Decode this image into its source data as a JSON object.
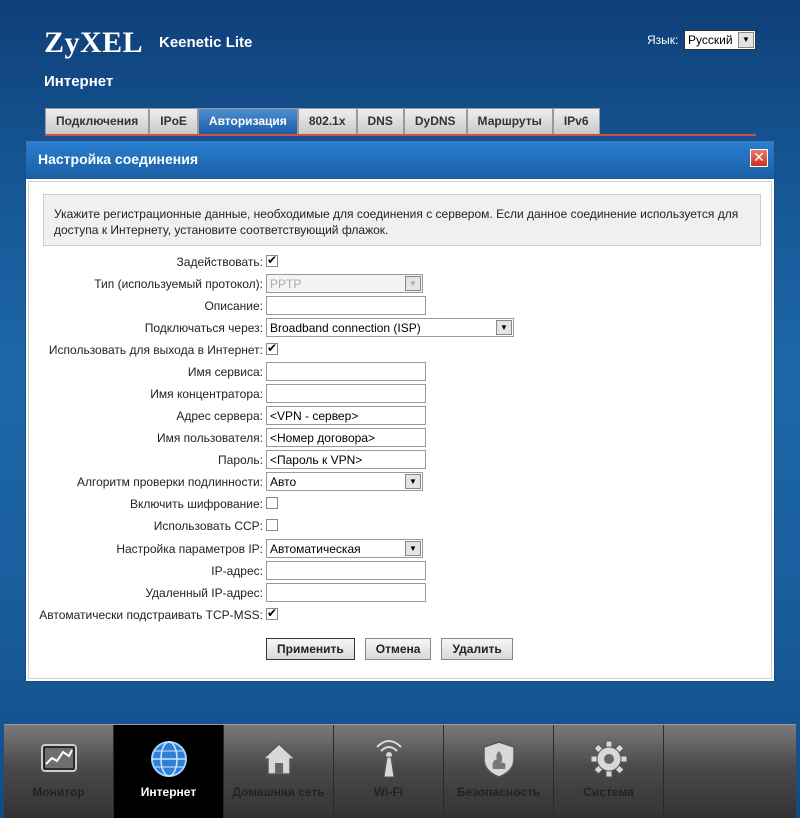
{
  "brand": {
    "logo": "ZyXEL",
    "model": "Keenetic Lite"
  },
  "language": {
    "label": "Язык:",
    "selected": "Русский"
  },
  "section_title": "Интернет",
  "tabs": [
    {
      "label": "Подключения"
    },
    {
      "label": "IPoE"
    },
    {
      "label": "Авторизация"
    },
    {
      "label": "802.1x"
    },
    {
      "label": "DNS"
    },
    {
      "label": "DyDNS"
    },
    {
      "label": "Маршруты"
    },
    {
      "label": "IPv6"
    }
  ],
  "dialog": {
    "title": "Настройка соединения",
    "close": "✕",
    "info": "Укажите регистрационные данные, необходимые для соединения с сервером. Если данное соединение используется для доступа к Интернету, установите соответствующий флажок.",
    "fields": {
      "enable": {
        "label": "Задействовать:",
        "checked": true
      },
      "type": {
        "label": "Тип (используемый протокол):",
        "value": "PPTP"
      },
      "description": {
        "label": "Описание:",
        "value": ""
      },
      "via": {
        "label": "Подключаться через:",
        "value": "Broadband connection (ISP)"
      },
      "internet": {
        "label": "Использовать для выхода в Интернет:",
        "checked": true
      },
      "service": {
        "label": "Имя сервиса:",
        "value": ""
      },
      "concentrator": {
        "label": "Имя концентратора:",
        "value": ""
      },
      "server": {
        "label": "Адрес сервера:",
        "value": "<VPN - сервер>"
      },
      "username": {
        "label": "Имя пользователя:",
        "value": "<Номер договора>"
      },
      "password": {
        "label": "Пароль:",
        "value": "<Пароль к VPN>"
      },
      "auth": {
        "label": "Алгоритм проверки подлинности:",
        "value": "Авто"
      },
      "encryption": {
        "label": "Включить шифрование:",
        "checked": false
      },
      "ccp": {
        "label": "Использовать CCP:",
        "checked": false
      },
      "ipsettings": {
        "label": "Настройка параметров IP:",
        "value": "Автоматическая"
      },
      "ip": {
        "label": "IP-адрес:",
        "value": ""
      },
      "remoteip": {
        "label": "Удаленный IP-адрес:",
        "value": ""
      },
      "tcpmss": {
        "label": "Автоматически подстраивать TCP-MSS:",
        "checked": true
      }
    },
    "buttons": {
      "apply": "Применить",
      "cancel": "Отмена",
      "delete": "Удалить"
    }
  },
  "dock": [
    {
      "label": "Монитор",
      "icon": "monitor-icon"
    },
    {
      "label": "Интернет",
      "icon": "globe-icon"
    },
    {
      "label": "Домашняя сеть",
      "icon": "home-icon"
    },
    {
      "label": "Wi-Fi",
      "icon": "wifi-icon"
    },
    {
      "label": "Безопасность",
      "icon": "shield-icon"
    },
    {
      "label": "Система",
      "icon": "gear-icon"
    }
  ]
}
